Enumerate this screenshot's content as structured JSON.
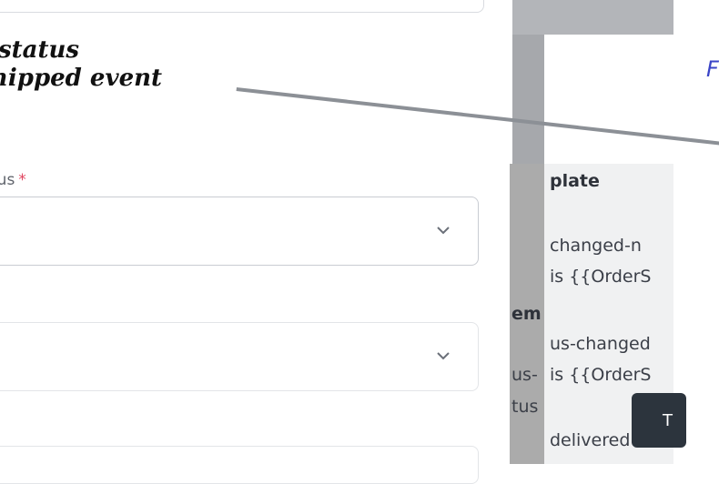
{
  "heading": {
    "line1": "status",
    "line2": "hipped event"
  },
  "fields": [
    {
      "label": "tus",
      "required_marker": "*"
    },
    {
      "label": ""
    },
    {
      "label": ""
    }
  ],
  "right_panel": {
    "header_fragment": "plate",
    "row_header_fragment": "em",
    "rows": [
      {
        "line1": "changed-n",
        "line2": "is {{OrderS"
      },
      {
        "line1": "us-changed",
        "line2": "is {{OrderS"
      },
      {
        "line1": "delivered",
        "line2": ""
      }
    ],
    "left_col_row": {
      "line1": "us-",
      "line2": "tus"
    }
  },
  "tooltip_text": "T",
  "blue_fragment": "F",
  "icons": {
    "select_chevron": "chevron-down-icon"
  }
}
